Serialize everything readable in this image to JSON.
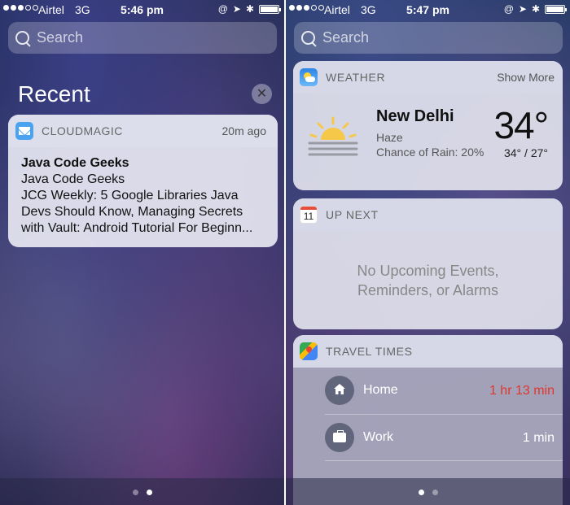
{
  "left": {
    "status": {
      "carrier": "Airtel",
      "network": "3G",
      "time": "5:46 pm"
    },
    "search": {
      "placeholder": "Search"
    },
    "recent": {
      "title": "Recent",
      "clear_icon": "close-icon",
      "notification": {
        "app_icon": "mail-icon",
        "app_name": "CLOUDMAGIC",
        "time": "20m ago",
        "title": "Java Code Geeks",
        "subtitle": "Java Code Geeks",
        "message": "JCG Weekly: 5 Google Libraries Java Devs Should Know, Managing Secrets with Vault: Android Tutorial For Beginn..."
      }
    }
  },
  "right": {
    "status": {
      "carrier": "Airtel",
      "network": "3G",
      "time": "5:47 pm"
    },
    "search": {
      "placeholder": "Search"
    },
    "weather": {
      "app_name": "WEATHER",
      "show_more": "Show More",
      "icon": "sun-icon",
      "city": "New Delhi",
      "condition": "Haze",
      "rain": "Chance of Rain: 20%",
      "temp": "34°",
      "hilo": "34° / 27°"
    },
    "upnext": {
      "app_name": "UP NEXT",
      "calendar_day": "11",
      "line1": "No Upcoming Events,",
      "line2": "Reminders, or Alarms"
    },
    "travel": {
      "app_name": "TRAVEL TIMES",
      "rows": [
        {
          "label": "Home",
          "value": "1 hr 13 min",
          "icon": "home-icon",
          "color": "#e0362c"
        },
        {
          "label": "Work",
          "value": "1 min",
          "icon": "briefcase-icon",
          "color": "#ffffff"
        }
      ]
    }
  },
  "colors": {
    "accent_red": "#e0362c",
    "mail_blue": "#4aa3f0"
  }
}
